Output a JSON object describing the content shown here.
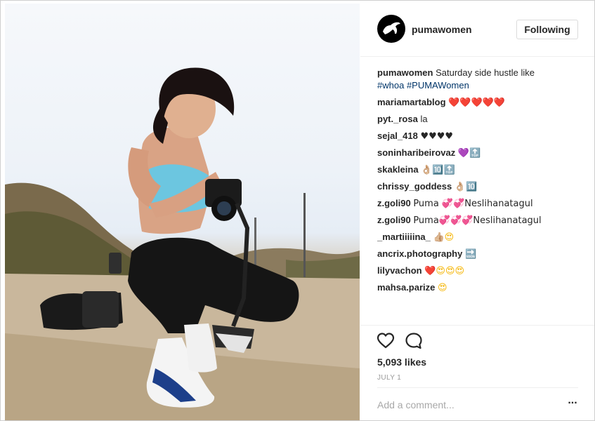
{
  "header": {
    "username": "pumawomen",
    "follow_label": "Following"
  },
  "caption": {
    "username": "pumawomen",
    "text": "Saturday side hustle like",
    "tags": [
      "#whoa",
      "#PUMAWomen"
    ]
  },
  "comments": [
    {
      "username": "mariamartablog",
      "text": "❤️❤️❤️❤️❤️"
    },
    {
      "username": "pyt._rosa",
      "text": "la"
    },
    {
      "username": "sejal_418",
      "text": "♥♥♥♥"
    },
    {
      "username": "soninharibeirovaz",
      "text": "💜🔝"
    },
    {
      "username": "skakleina",
      "text": "👌🏼🔟🔝"
    },
    {
      "username": "chrissy_goddess",
      "text": "👌🏼🔟"
    },
    {
      "username": "z.goli90",
      "text": "Puma 💞💞Neslihanatagul"
    },
    {
      "username": "z.goli90",
      "text": "Puma💞💞💞Neslihanatagul"
    },
    {
      "username": "_martiiiiina_",
      "text": "👍🏼😍"
    },
    {
      "username": "ancrix.photography",
      "text": "🔜"
    },
    {
      "username": "lilyvachon",
      "text": "❤️😍😍😍"
    },
    {
      "username": "mahsa.parize",
      "text": "😍"
    }
  ],
  "actions": {
    "like_icon": "heart-outline-icon",
    "comment_icon": "speech-bubble-icon",
    "more_icon": "ellipsis-icon"
  },
  "likes": "5,093 likes",
  "date": "JULY 1",
  "add_comment": {
    "placeholder": "Add a comment..."
  },
  "colors": {
    "tag": "#003569",
    "text": "#262626",
    "muted": "#999999",
    "border": "#efefef"
  }
}
